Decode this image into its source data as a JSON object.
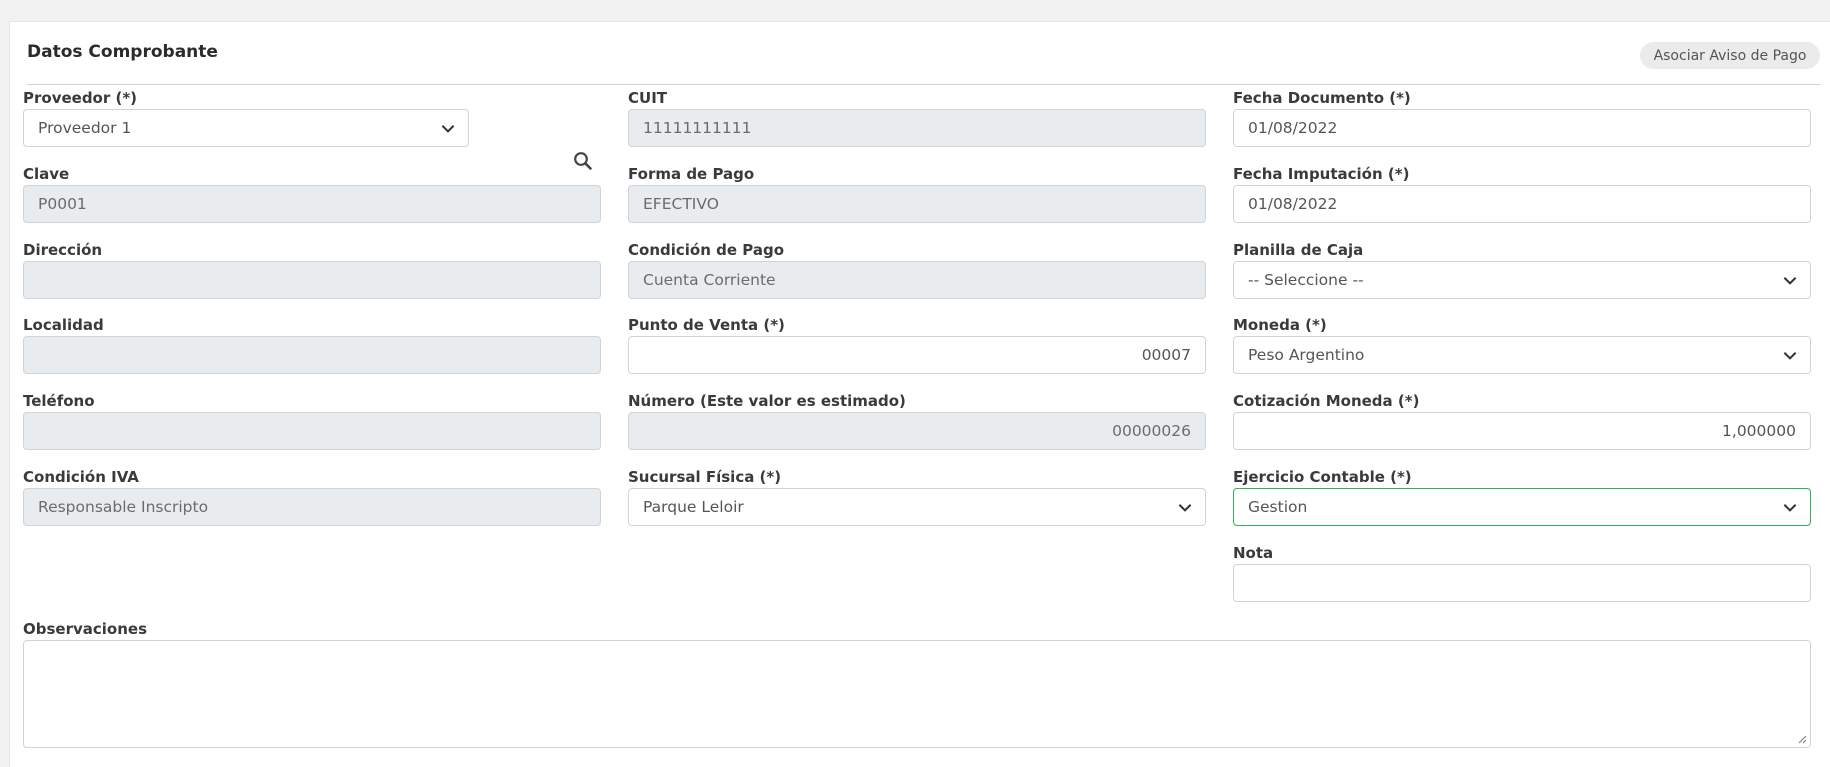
{
  "panel": {
    "title": "Datos Comprobante",
    "aviso_label": "Asociar Aviso de Pago"
  },
  "col1": {
    "proveedor": {
      "label": "Proveedor (*)",
      "value": "Proveedor 1"
    },
    "clave": {
      "label": "Clave",
      "value": "P0001"
    },
    "direccion": {
      "label": "Dirección",
      "value": ""
    },
    "localidad": {
      "label": "Localidad",
      "value": ""
    },
    "telefono": {
      "label": "Teléfono",
      "value": ""
    },
    "condicion_iva": {
      "label": "Condición IVA",
      "value": "Responsable Inscripto"
    }
  },
  "col2": {
    "cuit": {
      "label": "CUIT",
      "value": "11111111111"
    },
    "forma_pago": {
      "label": "Forma de Pago",
      "value": "EFECTIVO"
    },
    "condicion_pago": {
      "label": "Condición de Pago",
      "value": "Cuenta Corriente"
    },
    "punto_venta": {
      "label": "Punto de Venta (*)",
      "value": "00007"
    },
    "numero": {
      "label": "Número (Este valor es estimado)",
      "value": "00000026"
    },
    "sucursal": {
      "label": "Sucursal Física (*)",
      "value": "Parque Leloir"
    }
  },
  "col3": {
    "fecha_documento": {
      "label": "Fecha Documento (*)",
      "value": "01/08/2022"
    },
    "fecha_imputacion": {
      "label": "Fecha Imputación (*)",
      "value": "01/08/2022"
    },
    "planilla_caja": {
      "label": "Planilla de Caja",
      "value": "-- Seleccione --"
    },
    "moneda": {
      "label": "Moneda (*)",
      "value": "Peso Argentino"
    },
    "cotizacion": {
      "label": "Cotización Moneda (*)",
      "value": "1,000000"
    },
    "ejercicio": {
      "label": "Ejercicio Contable (*)",
      "value": "Gestion"
    },
    "nota": {
      "label": "Nota",
      "value": ""
    }
  },
  "observaciones": {
    "label": "Observaciones",
    "value": ""
  },
  "icons": {
    "dropdown": "chevron-down-icon",
    "search": "search-icon",
    "resize": "resize-grip-icon"
  },
  "colors": {
    "readonly_bg": "#e9ecef",
    "border": "#cfd4da",
    "focus_border": "#2fb35b"
  }
}
